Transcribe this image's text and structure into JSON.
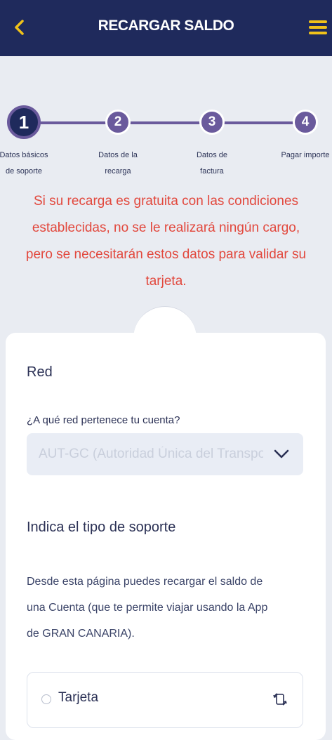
{
  "header": {
    "title": "RECARGAR SALDO",
    "back_icon": "chevron-left-icon",
    "menu_icon": "hamburger-menu-icon",
    "accent_color": "#f0c21a",
    "background_color": "#1f2a5c"
  },
  "stepper": {
    "steps": [
      {
        "number": "1",
        "label_line1": "Datos básicos",
        "label_line2": "de soporte",
        "active": true
      },
      {
        "number": "2",
        "label_line1": "Datos de la",
        "label_line2": "recarga",
        "active": false
      },
      {
        "number": "3",
        "label_line1": "Datos de",
        "label_line2": "factura",
        "active": false
      },
      {
        "number": "4",
        "label_line1": "Pagar importe",
        "label_line2": "",
        "active": false
      }
    ]
  },
  "notice": {
    "line1": "Si su recarga es gratuita con las condiciones",
    "line2": "establecidas, no se le realizará ningún cargo,",
    "line3": "pero se necesitarán estos datos para validar su",
    "line4": "tarjeta.",
    "color": "#e2483d"
  },
  "form": {
    "red_title": "Red",
    "red_question": "¿A qué red pertenece tu cuenta?",
    "red_select_value": "AUT-GC (Autoridad Única del Transporte de Gran Canaria)",
    "support_title": "Indica el tipo de soporte",
    "support_description_line1": "Desde esta página puedes recargar el saldo de",
    "support_description_line2": "una Cuenta (que te permite viajar usando la App",
    "support_description_line3": "de GRAN CANARIA).",
    "options": [
      {
        "label": "Tarjeta",
        "icon": "card-sync-icon",
        "selected": false
      }
    ]
  }
}
